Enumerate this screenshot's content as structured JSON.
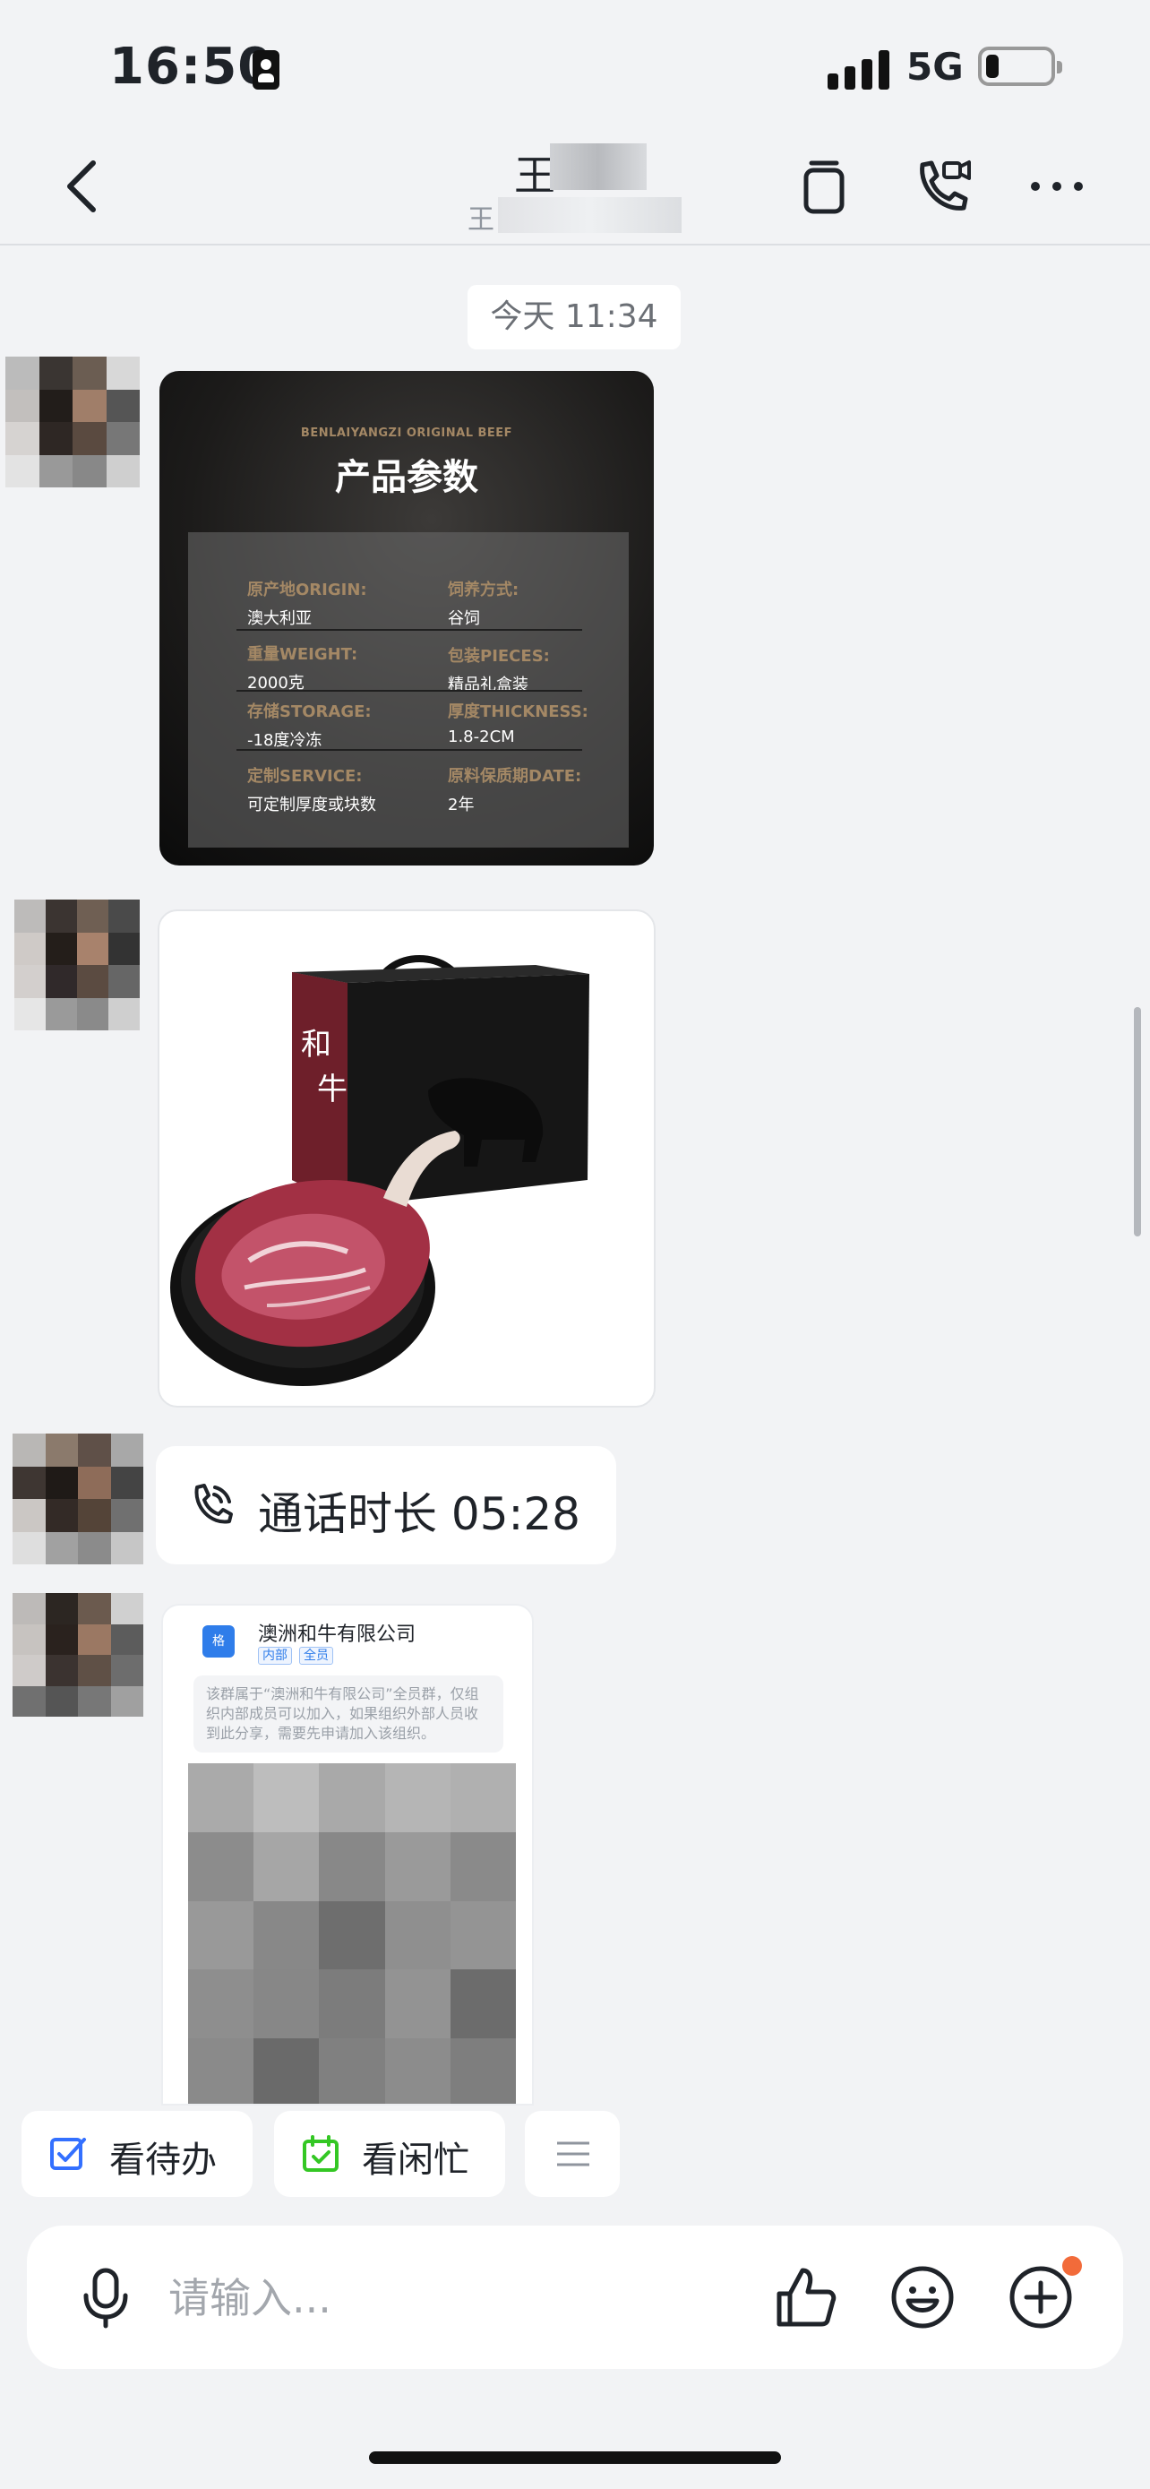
{
  "status_bar": {
    "time": "16:50",
    "network": "5G"
  },
  "header": {
    "title_visible": "王",
    "subtitle_visible": "王",
    "back_icon": "chevron-left-icon",
    "actions": [
      "copy-icon",
      "video-call-icon",
      "more-icon"
    ]
  },
  "chat": {
    "timestamp": "今天 11:34",
    "params_card": {
      "brand": "BENLAIYANGZI ORIGINAL BEEF",
      "title": "产品参数",
      "rows": [
        {
          "l1": "原产地ORIGIN:",
          "v1": "澳大利亚",
          "l2": "饲养方式:",
          "v2": "谷饲"
        },
        {
          "l1": "重量WEIGHT:",
          "v1": "2000克",
          "l2": "包装PIECES:",
          "v2": "精品礼盒装"
        },
        {
          "l1": "存储STORAGE:",
          "v1": "-18度冷冻",
          "l2": "厚度THICKNESS:",
          "v2": "1.8-2CM"
        },
        {
          "l1": "定制SERVICE:",
          "v1": "可定制厚度或块数",
          "l2": "原料保质期DATE:",
          "v2": "2年"
        }
      ]
    },
    "product_card": {
      "box_text": "和牛"
    },
    "call": {
      "text": "通话时长 05:28"
    },
    "org_card": {
      "name": "澳洲和牛有限公司",
      "tag_internal": "内部",
      "tag_all": "全员",
      "description": "该群属于“澳洲和牛有限公司”全员群，仅组织内部成员可以加入，如果组织外部人员收到此分享，需要先申请加入该组织。"
    }
  },
  "quick_actions": [
    {
      "label": "看待办",
      "icon": "todo-check-icon",
      "color": "#3370ff"
    },
    {
      "label": "看闲忙",
      "icon": "calendar-icon",
      "color": "#34c724"
    }
  ],
  "input_bar": {
    "placeholder": "请输入..."
  }
}
